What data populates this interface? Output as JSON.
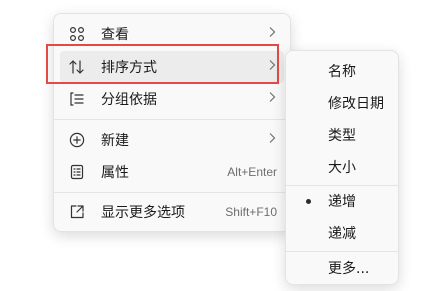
{
  "main_menu": {
    "items": [
      {
        "label": "查看",
        "icon": "grid-view-icon",
        "submenu": true
      },
      {
        "label": "排序方式",
        "icon": "sort-arrows-icon",
        "submenu": true
      },
      {
        "label": "分组依据",
        "icon": "group-list-icon",
        "submenu": true
      },
      {
        "label": "新建",
        "icon": "add-circle-icon",
        "submenu": true
      },
      {
        "label": "属性",
        "icon": "properties-icon",
        "shortcut": "Alt+Enter"
      },
      {
        "label": "显示更多选项",
        "icon": "expand-icon",
        "shortcut": "Shift+F10"
      }
    ]
  },
  "sort_submenu": {
    "items": [
      {
        "label": "名称"
      },
      {
        "label": "修改日期"
      },
      {
        "label": "类型"
      },
      {
        "label": "大小"
      },
      {
        "label": "递增",
        "selected": true
      },
      {
        "label": "递减"
      },
      {
        "label": "更多..."
      }
    ]
  },
  "colors": {
    "highlight_border": "#e24a48",
    "menu_background": "#f9f9f9",
    "separator": "#e4e4e4"
  }
}
